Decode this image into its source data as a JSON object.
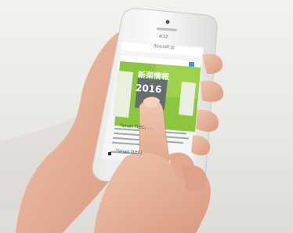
{
  "photo": {
    "subject": "",
    "colors": {
      "background": "#efeeeb",
      "phone_body": "#f7f7f5",
      "skin": "#e8b8a0",
      "screen_green": "#7fc42e",
      "screen_dark": "#6b6f70"
    }
  },
  "phone_screen": {
    "status_time": "4:12",
    "url_text": "flexcraft.jp",
    "headline_jp": "新栗情報",
    "headline_year": "2016",
    "body_text_1": "「Smart TLEC」...",
    "body_text_2": "「Smart TLEC」"
  }
}
